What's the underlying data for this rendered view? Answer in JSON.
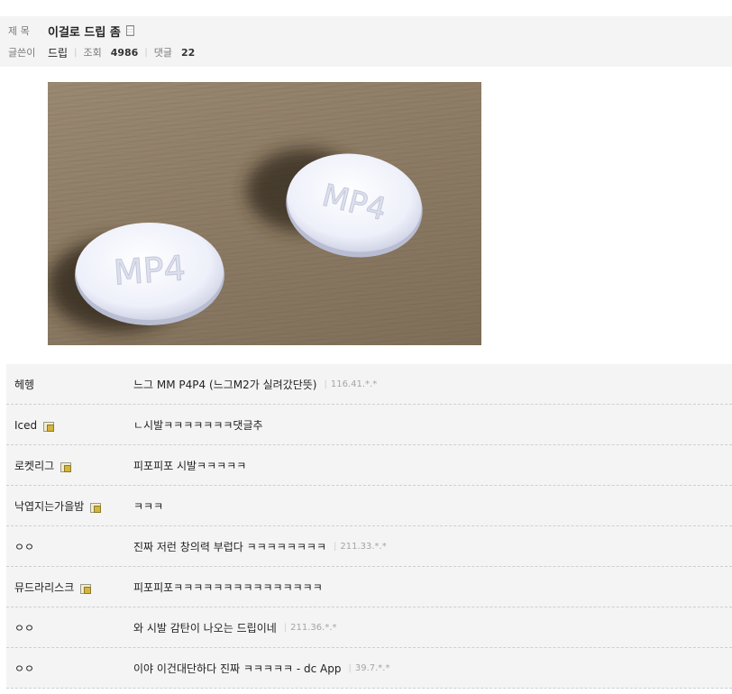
{
  "post": {
    "title_label": "제 목",
    "title": "이걸로 드립 좀",
    "author_label": "글쓴이",
    "author": "드립",
    "views_label": "조회",
    "views": "4986",
    "comments_label": "댓글",
    "comments_count": "22"
  },
  "image": {
    "pills": [
      "MP4",
      "MP4"
    ]
  },
  "comments": [
    {
      "name": "헤헹",
      "text": "느그 MM P4P4 (느그M2가 실려갔단뜻)",
      "ip": "116.41.*.*",
      "gallog": false
    },
    {
      "name": "Iced",
      "text": "ㄴ시발ㅋㅋㅋㅋㅋㅋㅋ댓글추",
      "ip": "",
      "gallog": true
    },
    {
      "name": "로켓리그",
      "text": "피포피포 시발ㅋㅋㅋㅋㅋ",
      "ip": "",
      "gallog": true
    },
    {
      "name": "낙엽지는가을밤",
      "text": "ㅋㅋㅋ",
      "ip": "",
      "gallog": true
    },
    {
      "name": "ㅇㅇ",
      "text": "진짜 저런 창의력 부럽다 ㅋㅋㅋㅋㅋㅋㅋㅋ",
      "ip": "211.33.*.*",
      "gallog": false
    },
    {
      "name": "뮤드라리스크",
      "text": "피포피포ㅋㅋㅋㅋㅋㅋㅋㅋㅋㅋㅋㅋㅋㅋㅋ",
      "ip": "",
      "gallog": true
    },
    {
      "name": "ㅇㅇ",
      "text": "와 시발 감탄이 나오는 드립이네",
      "ip": "211.36.*.*",
      "gallog": false
    },
    {
      "name": "ㅇㅇ",
      "text": "이야 이건대단하다 진짜 ㅋㅋㅋㅋㅋ - dc App",
      "ip": "39.7.*.*",
      "gallog": false
    }
  ]
}
